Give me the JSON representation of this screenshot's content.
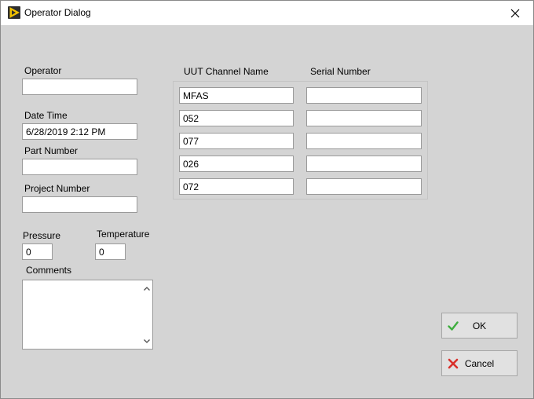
{
  "window": {
    "title": "Operator Dialog"
  },
  "form": {
    "operator_label": "Operator",
    "operator_value": "",
    "datetime_label": "Date Time",
    "datetime_value": "6/28/2019 2:12 PM",
    "part_number_label": "Part Number",
    "part_number_value": "",
    "project_number_label": "Project Number",
    "project_number_value": "",
    "pressure_label": "Pressure",
    "pressure_value": "0",
    "temperature_label": "Temperature",
    "temperature_value": "0",
    "comments_label": "Comments",
    "comments_value": ""
  },
  "channels": {
    "col_name_header": "UUT Channel Name",
    "col_serial_header": "Serial Number",
    "rows": [
      {
        "name": "MFAS",
        "serial": ""
      },
      {
        "name": "052",
        "serial": ""
      },
      {
        "name": "077",
        "serial": ""
      },
      {
        "name": "026",
        "serial": ""
      },
      {
        "name": "072",
        "serial": ""
      }
    ]
  },
  "buttons": {
    "ok_label": "OK",
    "cancel_label": "Cancel"
  },
  "icons": {
    "app": "labview-run-arrow-icon",
    "close": "close-icon",
    "ok": "check-icon",
    "cancel": "x-icon",
    "scroll_up": "chevron-up-icon",
    "scroll_down": "chevron-down-icon"
  },
  "colors": {
    "background": "#d4d4d4",
    "ok_icon": "#3fae3f",
    "cancel_icon": "#d9302b",
    "app_icon": "#f2c200"
  }
}
